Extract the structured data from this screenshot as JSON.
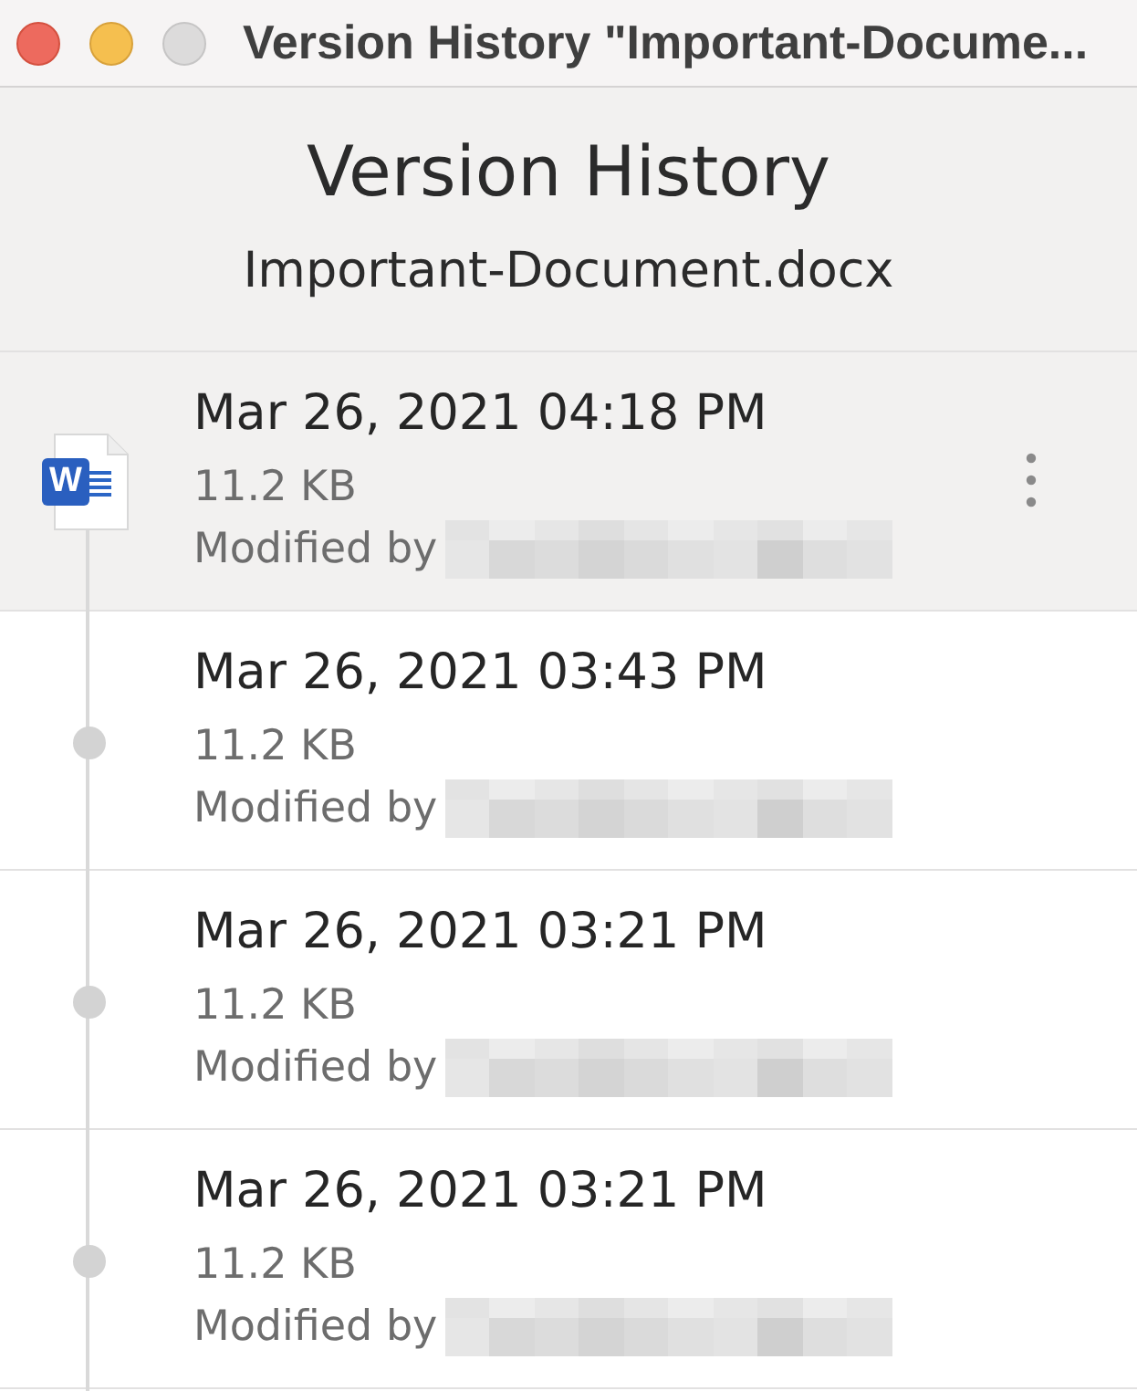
{
  "window": {
    "title": "Version History \"Important-Docume...",
    "buttons": [
      {
        "kind": "close",
        "disabled": false
      },
      {
        "kind": "minimize",
        "disabled": false
      },
      {
        "kind": "zoom",
        "disabled": true
      }
    ]
  },
  "header": {
    "title": "Version History",
    "filename": "Important-Document.docx"
  },
  "versions": [
    {
      "kind": "current",
      "badge": "W",
      "date": "Mar 26, 2021 04:18 PM",
      "size": "11.2 KB",
      "modified_label": "Modified by",
      "selected": true
    },
    {
      "kind": "previous",
      "date": "Mar 26, 2021 03:43 PM",
      "size": "11.2 KB",
      "modified_label": "Modified by",
      "selected": false
    },
    {
      "kind": "previous",
      "date": "Mar 26, 2021 03:21 PM",
      "size": "11.2 KB",
      "modified_label": "Modified by",
      "selected": false
    },
    {
      "kind": "previous",
      "date": "Mar 26, 2021 03:21 PM",
      "size": "11.2 KB",
      "modified_label": "Modified by",
      "selected": false
    }
  ]
}
